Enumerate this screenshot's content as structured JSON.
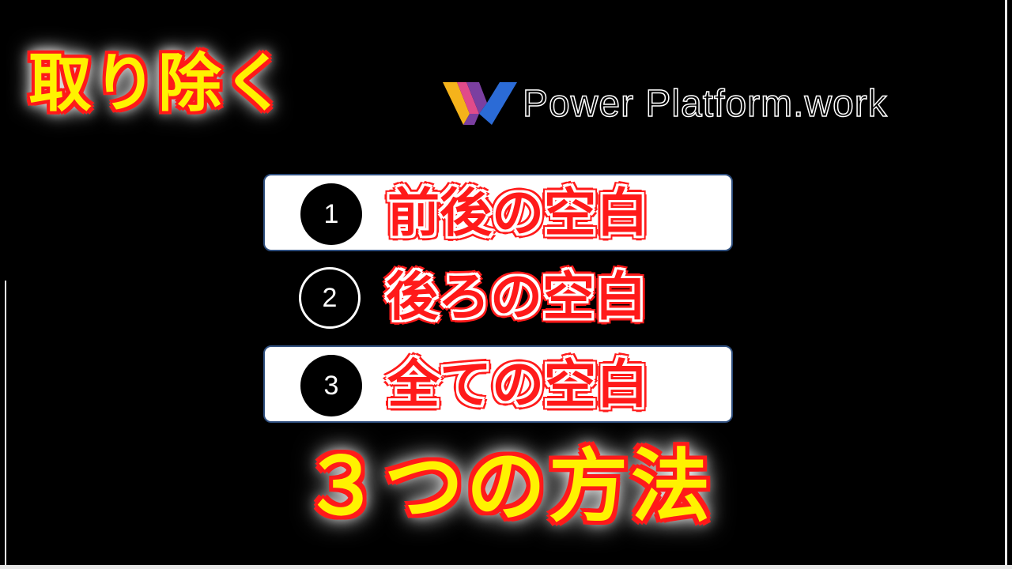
{
  "heading_top": "取り除く",
  "logo": {
    "text": "Power Platform.work",
    "colors": [
      "#f5b31b",
      "#7b3fa0",
      "#2b6bd6",
      "#e14b8a"
    ]
  },
  "items": [
    {
      "number": "1",
      "label": "前後の空白",
      "boxed": true
    },
    {
      "number": "2",
      "label": "後ろの空白",
      "boxed": false
    },
    {
      "number": "3",
      "label": "全ての空白",
      "boxed": true
    }
  ],
  "heading_bottom": "３つの方法",
  "colors": {
    "background": "#000000",
    "accent_red": "#ff1a1a",
    "accent_yellow": "#fff200",
    "box_border": "#2f4f7f"
  }
}
